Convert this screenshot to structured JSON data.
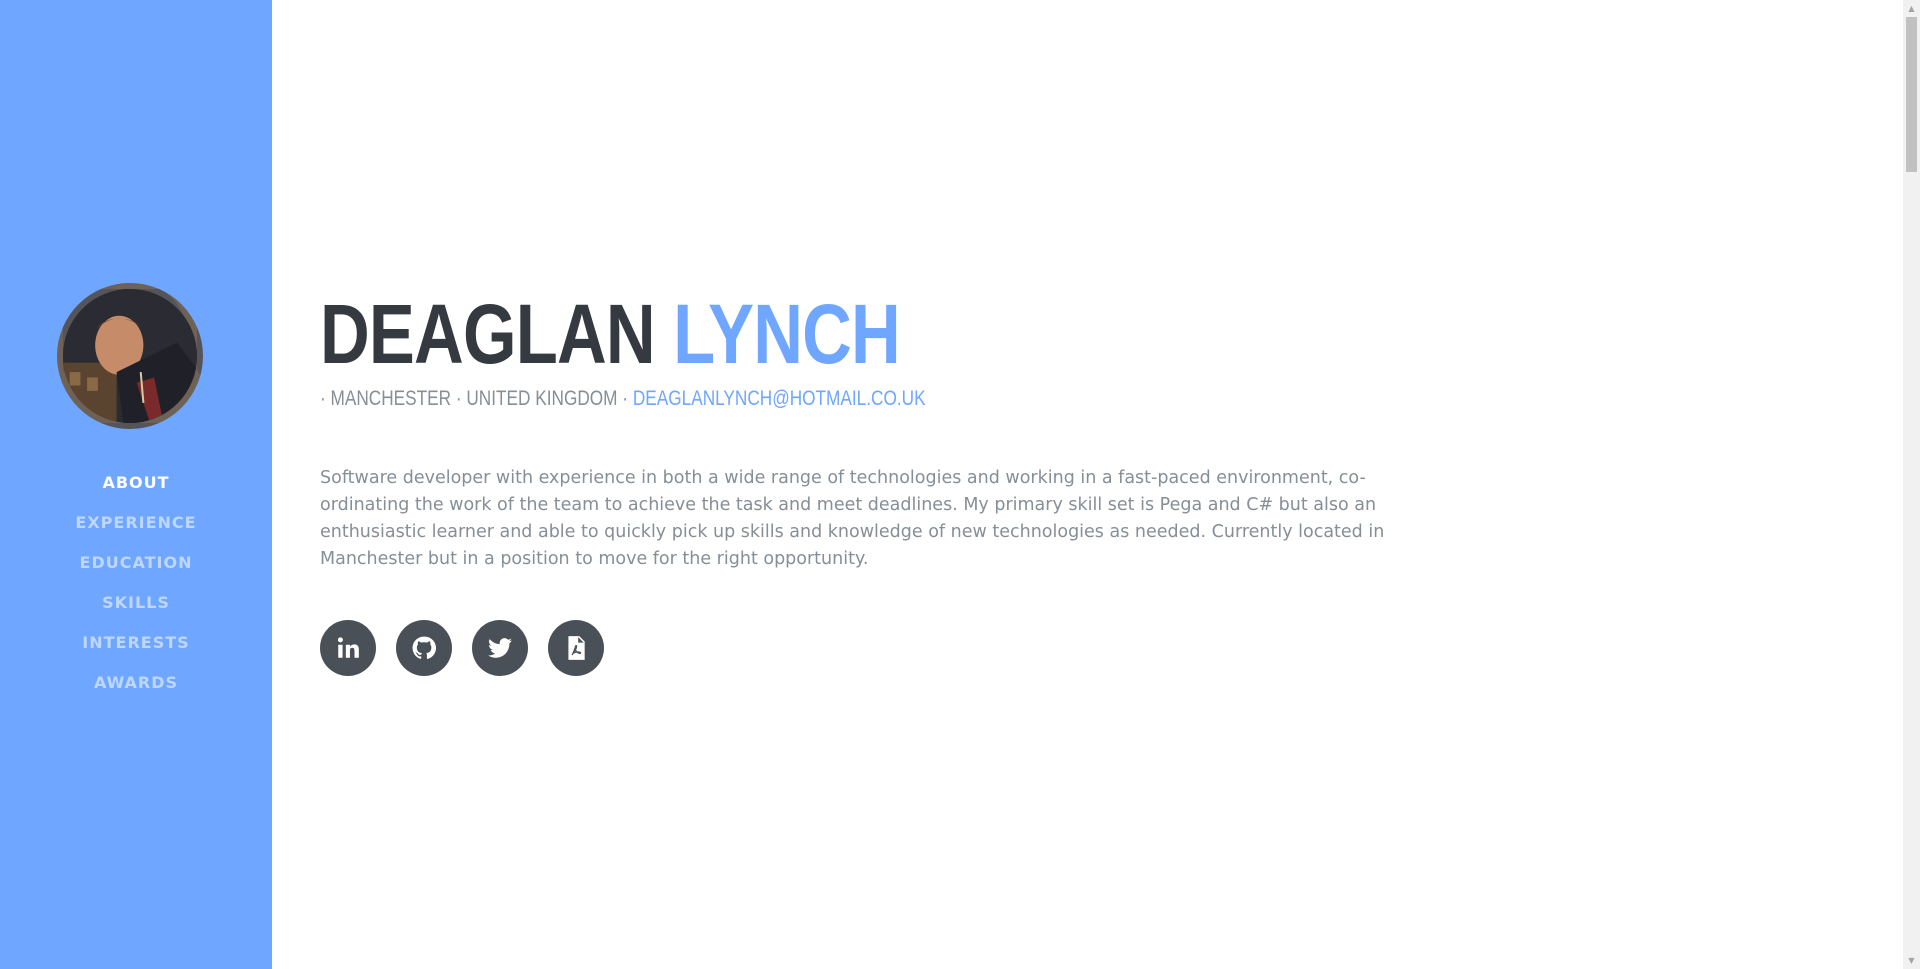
{
  "sidebar": {
    "nav": [
      {
        "label": "ABOUT",
        "active": true
      },
      {
        "label": "EXPERIENCE",
        "active": false
      },
      {
        "label": "EDUCATION",
        "active": false
      },
      {
        "label": "SKILLS",
        "active": false
      },
      {
        "label": "INTERESTS",
        "active": false
      },
      {
        "label": "AWARDS",
        "active": false
      }
    ]
  },
  "about": {
    "first_name": "DEAGLAN",
    "last_name": "LYNCH",
    "location_prefix": "· MANCHESTER · UNITED KINGDOM · ",
    "email": "DEAGLANLYNCH@HOTMAIL.CO.UK",
    "bio": "Software developer with experience in both a wide range of technologies and working in a fast-paced environment, co-ordinating the work of the team to achieve the task and meet deadlines. My primary skill set is Pega and C# but also an enthusiastic learner and able to quickly pick up skills and knowledge of new technologies as needed. Currently located in Manchester but in a position to move for the right opportunity."
  },
  "social_icons": [
    "linkedin-icon",
    "github-icon",
    "twitter-icon",
    "pdf-file-icon"
  ],
  "colors": {
    "sidebar": "#6fa6ff",
    "accent": "#6fa6ff",
    "heading": "#343a40",
    "muted": "#868e96",
    "icon_bg": "#495057"
  }
}
